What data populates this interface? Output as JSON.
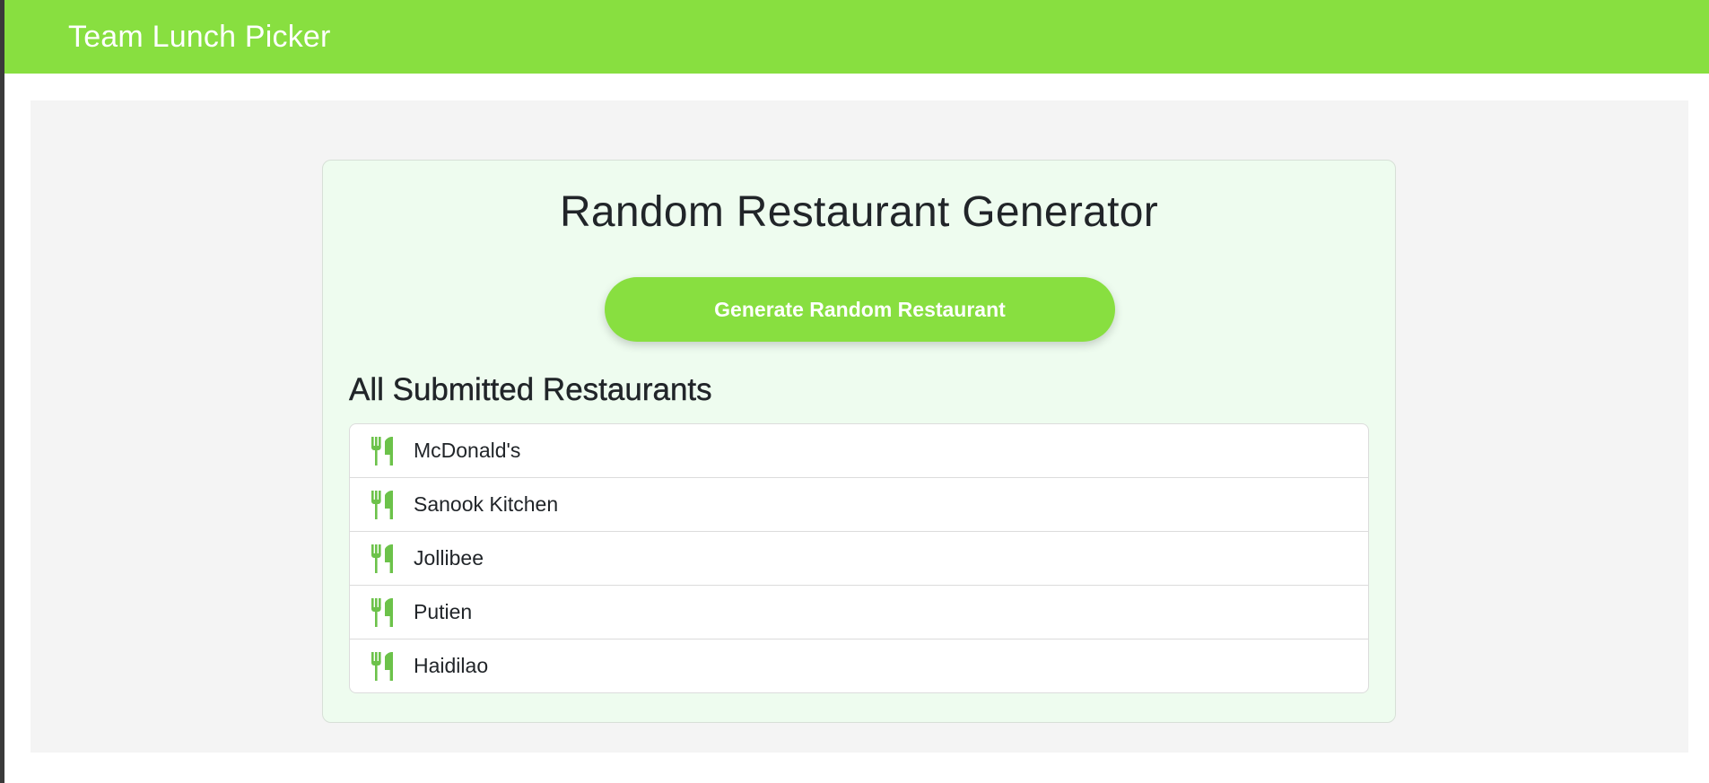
{
  "navbar": {
    "brand": "Team Lunch Picker"
  },
  "card": {
    "title": "Random Restaurant Generator",
    "generate_button_label": "Generate Random Restaurant",
    "list_title": "All Submitted Restaurants",
    "restaurants": [
      {
        "name": "McDonald's",
        "icon": "utensils-icon"
      },
      {
        "name": "Sanook Kitchen",
        "icon": "utensils-icon"
      },
      {
        "name": "Jollibee",
        "icon": "utensils-icon"
      },
      {
        "name": "Putien",
        "icon": "utensils-icon"
      },
      {
        "name": "Haidilao",
        "icon": "utensils-icon"
      }
    ]
  },
  "colors": {
    "accent": "#88df40",
    "icon": "#6cc24a",
    "card_bg": "#eefcef",
    "page_bg": "#f4f4f4"
  }
}
